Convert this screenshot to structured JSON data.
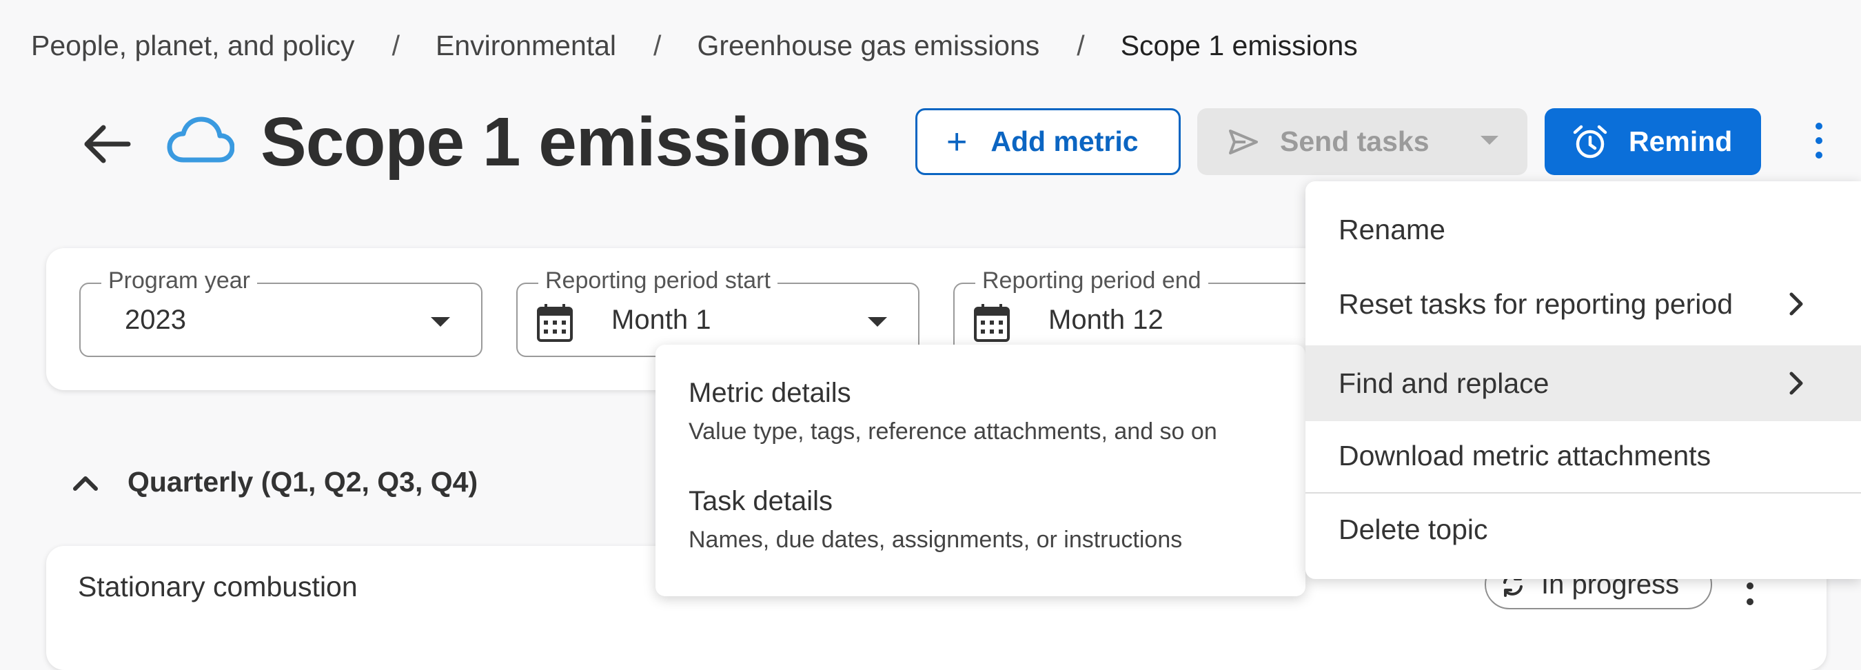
{
  "breadcrumb": {
    "items": [
      "People, planet, and policy",
      "Environmental",
      "Greenhouse gas emissions"
    ],
    "current": "Scope 1 emissions",
    "separator": "/"
  },
  "header": {
    "title": "Scope 1 emissions",
    "icon": "cloud-icon",
    "add_metric_label": "Add metric",
    "send_tasks_label": "Send tasks",
    "remind_label": "Remind"
  },
  "filters": {
    "program_year": {
      "label": "Program year",
      "value": "2023"
    },
    "period_start": {
      "label": "Reporting period start",
      "value": "Month 1"
    },
    "period_end": {
      "label": "Reporting period end",
      "value": "Month 12"
    }
  },
  "section": {
    "title": "Quarterly (Q1, Q2, Q3, Q4)"
  },
  "row": {
    "label": "Stationary combustion",
    "status": "In progress"
  },
  "menu": {
    "items": [
      {
        "label": "Rename"
      },
      {
        "label": "Reset tasks for reporting period"
      },
      {
        "label": "Find and replace"
      },
      {
        "label": "Download metric attachments"
      },
      {
        "label": "Delete topic"
      }
    ]
  },
  "submenu": {
    "items": [
      {
        "title": "Metric details",
        "description": "Value type, tags, reference attachments, and so on"
      },
      {
        "title": "Task details",
        "description": "Names, due dates, assignments, or instructions"
      }
    ]
  },
  "colors": {
    "accent": "#0b6fd9",
    "cloud": "#3a9ae0",
    "disabled_bg": "#e6e6e6",
    "page_bg": "#f8f8f9"
  }
}
